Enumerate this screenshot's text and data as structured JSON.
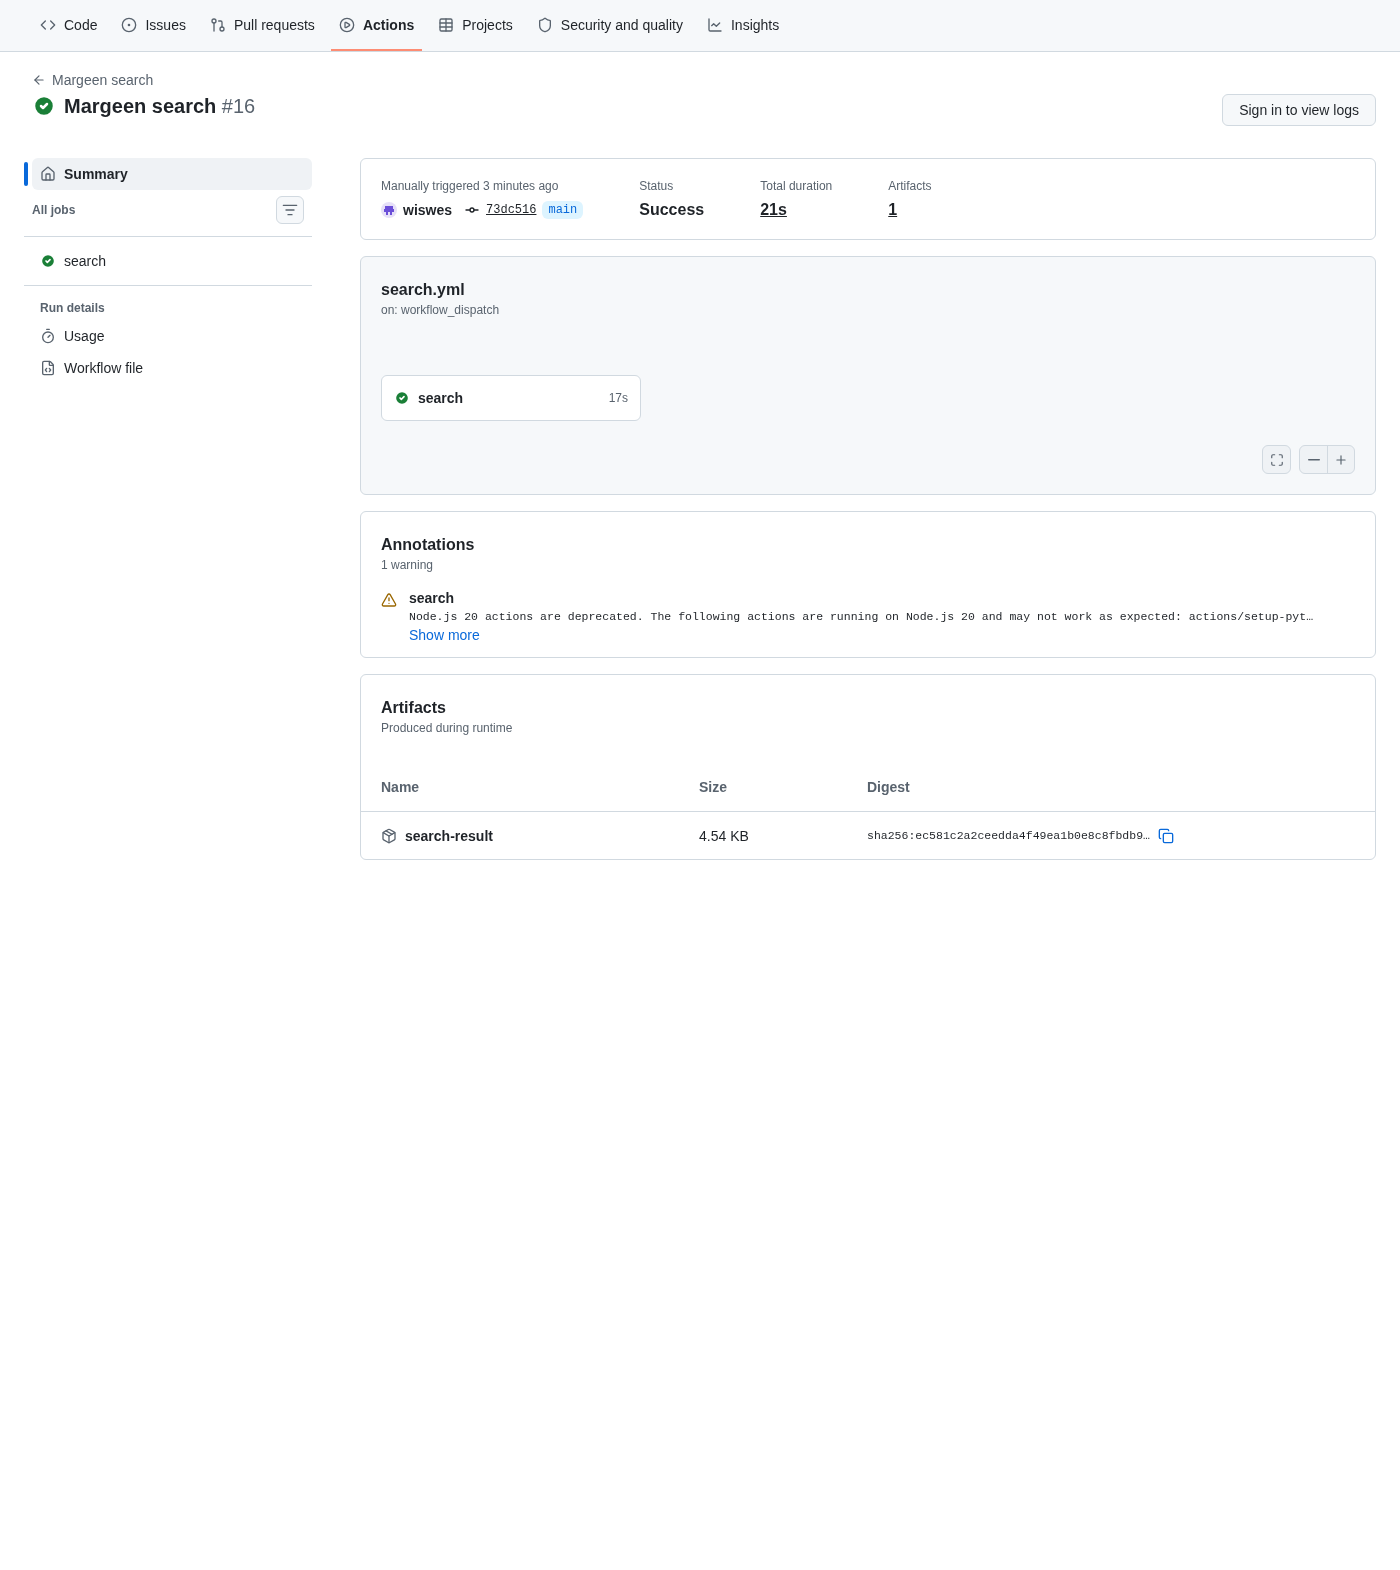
{
  "nav": [
    {
      "label": "Code",
      "selected": false
    },
    {
      "label": "Issues",
      "selected": false
    },
    {
      "label": "Pull requests",
      "selected": false
    },
    {
      "label": "Actions",
      "selected": true
    },
    {
      "label": "Projects",
      "selected": false
    },
    {
      "label": "Security and quality",
      "selected": false
    },
    {
      "label": "Insights",
      "selected": false
    }
  ],
  "back_link": "Margeen search",
  "title": {
    "name": "Margeen search",
    "number": "#16",
    "kind": "success"
  },
  "sign_in_button": "Sign in to view logs",
  "sidebar": {
    "summary": {
      "label": "Summary",
      "selected": true
    },
    "jobs_heading": "All jobs",
    "jobs": [
      {
        "label": "search",
        "kind": "success",
        "selected": false
      }
    ],
    "run_details_heading": "Run details",
    "run_details": [
      {
        "label": "Usage",
        "selected": false
      },
      {
        "label": "Workflow file",
        "selected": false
      }
    ]
  },
  "run_info": {
    "trigger": "Manually triggered 3 minutes ago",
    "actor": "wiswes",
    "commit": "73dc516",
    "branch": "main",
    "stats": [
      {
        "label": "Status",
        "value": "Success",
        "link": false
      },
      {
        "label": "Total duration",
        "value": "21s",
        "link": true
      },
      {
        "label": "Artifacts",
        "value": "1",
        "link": true
      }
    ]
  },
  "workflow": {
    "file": "search.yml",
    "trigger": "on: workflow_dispatch",
    "jobs": [
      {
        "name": "search",
        "duration": "17s",
        "kind": "success"
      }
    ]
  },
  "annotations": {
    "title": "Annotations",
    "subtitle": "1 warning",
    "items": [
      {
        "job": "search",
        "message": "Node.js 20 actions are deprecated. The following actions are running on Node.js 20 and may not work as expected: actions/setup-pyt…",
        "link": "Show more"
      }
    ]
  },
  "artifacts": {
    "title": "Artifacts",
    "subtitle": "Produced during runtime",
    "columns": [
      "Name",
      "Size",
      "Digest"
    ],
    "rows": [
      {
        "name": "search-result",
        "size": "4.54 KB",
        "digest": "sha256:ec581c2a2ceedda4f49ea1b0e8c8fbdb9…"
      }
    ]
  }
}
